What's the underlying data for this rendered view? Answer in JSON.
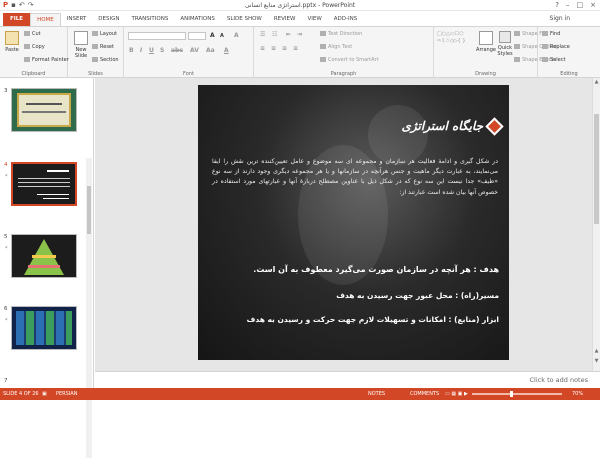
{
  "window": {
    "title": "استراتژی منابع انسانی.pptx - PowerPoint",
    "signin": "Sign in"
  },
  "tabs": [
    "FILE",
    "HOME",
    "INSERT",
    "DESIGN",
    "TRANSITIONS",
    "ANIMATIONS",
    "SLIDE SHOW",
    "REVIEW",
    "VIEW",
    "ADD-INS"
  ],
  "ribbon": {
    "clipboard": {
      "label": "Clipboard",
      "paste": "Paste",
      "cut": "Cut",
      "copy": "Copy",
      "format_painter": "Format Painter"
    },
    "slides": {
      "label": "Slides",
      "new_slide": "New Slide",
      "layout": "Layout",
      "reset": "Reset",
      "section": "Section"
    },
    "font": {
      "label": "Font"
    },
    "paragraph": {
      "label": "Paragraph",
      "text_direction": "Text Direction",
      "align_text": "Align Text",
      "convert": "Convert to SmartArt"
    },
    "drawing": {
      "label": "Drawing",
      "arrange": "Arrange",
      "quick_styles": "Quick Styles",
      "shape_fill": "Shape Fill",
      "shape_outline": "Shape Outline",
      "shape_effects": "Shape Effects"
    },
    "editing": {
      "label": "Editing",
      "find": "Find",
      "replace": "Replace",
      "select": "Select"
    }
  },
  "thumbnails": [
    {
      "num": "3",
      "star": ""
    },
    {
      "num": "4",
      "star": "*"
    },
    {
      "num": "5",
      "star": "*"
    },
    {
      "num": "6",
      "star": "*"
    },
    {
      "num": "7",
      "star": ""
    }
  ],
  "slide": {
    "title": "جایگاه استراتژی",
    "body": "در شکل گیری و ادامهٔ فعالیت هر سازمان و مجموعه ای سه موضوع و عامل تعیین‌کننده ترین نقش را ایفا می‌نمایند، به عبارت دیگر ماهیت و جنس هرآنچه در سازمانها و یا هر مجموعه دیگری وجود دارند از سه نوع «طیف» جدا نیست این سه نوع که در شکل ذیل با عناوین مصطلح دربارهٔ آنها و عبارتهای مورد استفاده در خصوص آنها بیان شده است عبارتند از:",
    "defs": [
      "هدف : هر آنچه در سازمان صورت می‌گیرد معطوف به آن است.",
      "مسیر(راه) : محل عبور جهت رسیدن به هدف",
      "ابزار (منابع) : امکانات و تسهیلات لازم جهت حرکت و رسیدن به هدف"
    ]
  },
  "notes_placeholder": "Click to add notes",
  "status": {
    "slide": "SLIDE 4 OF 26",
    "lang_icon": "▣",
    "language": "PERSIAN",
    "notes": "NOTES",
    "comments": "COMMENTS",
    "zoom": "70%"
  },
  "colors": {
    "accent": "#d24726"
  }
}
